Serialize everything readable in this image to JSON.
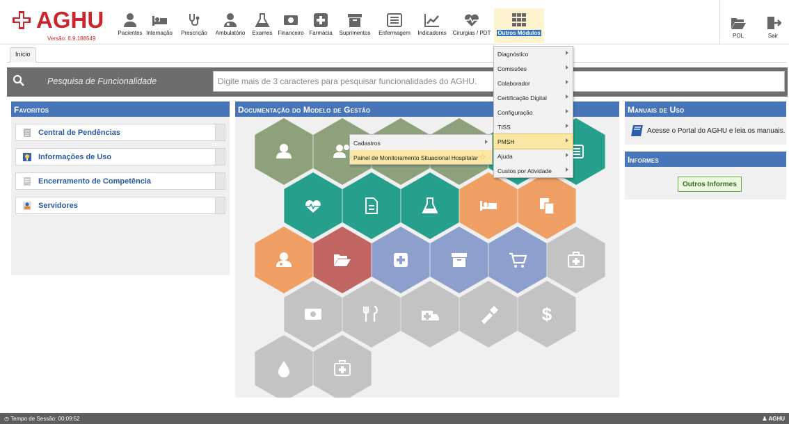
{
  "app": {
    "name": "AGHU",
    "version": "Versão: 6.9.188549"
  },
  "modules": [
    {
      "id": "pacientes",
      "label": "Pacientes",
      "icon": "person-icon"
    },
    {
      "id": "internacao",
      "label": "Internação",
      "icon": "bed-icon"
    },
    {
      "id": "prescricao",
      "label": "Prescrição",
      "icon": "stethoscope-icon"
    },
    {
      "id": "ambulatorio",
      "label": "Ambulatório",
      "icon": "doctor-icon"
    },
    {
      "id": "exames",
      "label": "Exames",
      "icon": "flask-icon"
    },
    {
      "id": "financeiro",
      "label": "Financeiro",
      "icon": "money-icon"
    },
    {
      "id": "farmacia",
      "label": "Farmácia",
      "icon": "plus-square-icon"
    },
    {
      "id": "suprimentos",
      "label": "Suprimentos",
      "icon": "archive-icon"
    },
    {
      "id": "enfermagem",
      "label": "Enfermagem",
      "icon": "list-icon"
    },
    {
      "id": "indicadores",
      "label": "Indicadores",
      "icon": "chart-line-icon"
    },
    {
      "id": "cirurgias",
      "label": "Cirurgias / PDT",
      "icon": "heartbeat-icon"
    },
    {
      "id": "outros",
      "label": "Outros Módulos",
      "icon": "grid-icon"
    }
  ],
  "right_modules": [
    {
      "label": "POL",
      "icon": "folder-open-icon"
    },
    {
      "label": "Sair",
      "icon": "exit-icon"
    }
  ],
  "tabs": [
    {
      "label": "Início"
    }
  ],
  "search": {
    "label": "Pesquisa de Funcionalidade",
    "placeholder": "Digite mais de 3 caracteres para pesquisar funcionalidades do AGHU."
  },
  "favoritos": {
    "title": "Favoritos",
    "items": [
      {
        "label": "Central de Pendências",
        "icon": "document-list-icon"
      },
      {
        "label": "Informações de Uso",
        "icon": "info-bulb-icon"
      },
      {
        "label": "Encerramento de Competência",
        "icon": "document-icon"
      },
      {
        "label": "Servidores",
        "icon": "user-card-icon"
      }
    ]
  },
  "documentacao": {
    "title": "Documentação do Modelo de Gestão"
  },
  "manuais": {
    "title": "Manuais de Uso",
    "text": "Acesse o Portal do AGHU e leia os manuais."
  },
  "informes": {
    "title": "Informes",
    "button": "Outros Informes"
  },
  "menu_outros": [
    {
      "label": "Diagnóstico"
    },
    {
      "label": "Comissões"
    },
    {
      "label": "Colaborador"
    },
    {
      "label": "Certificação Digital"
    },
    {
      "label": "Configuração"
    },
    {
      "label": "TISS"
    },
    {
      "label": "PMSH",
      "highlight": true
    },
    {
      "label": "Ajuda"
    },
    {
      "label": "Custos por Atividade"
    }
  ],
  "submenu_pmsh": [
    {
      "label": "Cadastros"
    },
    {
      "label": "Painel de Monitoramento Situacional Hospitalar",
      "highlight": true
    }
  ],
  "status": {
    "session": "Tempo de Sessão: 00:09:52",
    "user": "AGHU"
  },
  "colors": {
    "green": "#8da27c",
    "teal": "#26a08d",
    "orange": "#ef9f63",
    "red": "#c16563",
    "blue": "#8d9fcd",
    "gray": "#c3c3c3",
    "header": "#4874b8",
    "brand": "#c9252c"
  },
  "hexagons": [
    {
      "color": "green",
      "icon": "person-icon"
    },
    {
      "color": "green",
      "icon": "users-icon"
    },
    {
      "color": "green",
      "icon": ""
    },
    {
      "color": "green",
      "icon": ""
    },
    {
      "color": "teal",
      "icon": ""
    },
    {
      "color": "teal",
      "icon": "list-icon"
    },
    {
      "color": "teal",
      "icon": "heartbeat-icon"
    },
    {
      "color": "teal",
      "icon": "document-icon"
    },
    {
      "color": "teal",
      "icon": "flask-icon"
    },
    {
      "color": "orange",
      "icon": "bed-icon"
    },
    {
      "color": "orange",
      "icon": "copy-icon"
    },
    {
      "color": "orange",
      "icon": "doctor-icon"
    },
    {
      "color": "red",
      "icon": "folder-open-icon"
    },
    {
      "color": "blue",
      "icon": "plus-square-icon"
    },
    {
      "color": "blue",
      "icon": "archive-icon"
    },
    {
      "color": "blue",
      "icon": "cart-icon"
    },
    {
      "color": "gray",
      "icon": "medkit-icon"
    },
    {
      "color": "gray",
      "icon": "money-icon"
    },
    {
      "color": "gray",
      "icon": "cutlery-icon"
    },
    {
      "color": "gray",
      "icon": "ambulance-icon"
    },
    {
      "color": "gray",
      "icon": "eyedropper-icon"
    },
    {
      "color": "gray",
      "icon": "dollar-icon"
    },
    {
      "color": "gray",
      "icon": "drop-icon"
    },
    {
      "color": "gray",
      "icon": "medkit-icon"
    }
  ]
}
